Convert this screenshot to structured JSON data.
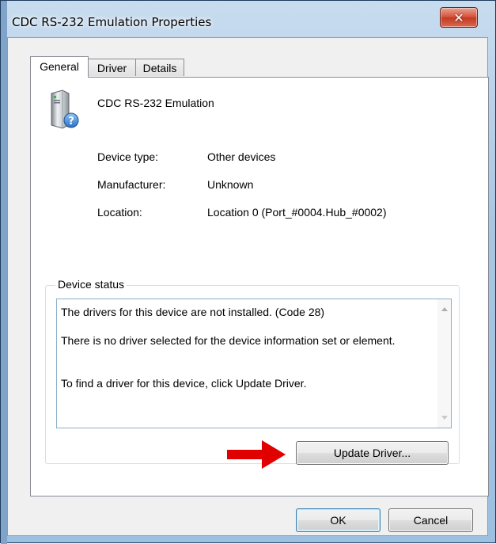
{
  "window": {
    "title": "CDC RS-232 Emulation Properties",
    "close_glyph": "✕"
  },
  "tabs": [
    {
      "label": "General",
      "active": true
    },
    {
      "label": "Driver",
      "active": false
    },
    {
      "label": "Details",
      "active": false
    }
  ],
  "device": {
    "name": "CDC RS-232 Emulation",
    "icon": "unknown-device-icon"
  },
  "properties": {
    "device_type": {
      "label": "Device type:",
      "value": "Other devices"
    },
    "manufacturer": {
      "label": "Manufacturer:",
      "value": "Unknown"
    },
    "location": {
      "label": "Location:",
      "value": "Location 0 (Port_#0004.Hub_#0002)"
    }
  },
  "device_status": {
    "legend": "Device status",
    "lines": [
      "The drivers for this device are not installed. (Code 28)",
      "There is no driver selected for the device information set or element.",
      "To find a driver for this device, click Update Driver."
    ]
  },
  "buttons": {
    "update_driver": "Update Driver...",
    "ok": "OK",
    "cancel": "Cancel"
  },
  "annotation": {
    "icon": "red-arrow-icon",
    "color": "#e10000"
  },
  "colors": {
    "title_bar": "#a9c7e4",
    "close_button": "#c33a22",
    "default_button_border": "#3c7fb1"
  }
}
